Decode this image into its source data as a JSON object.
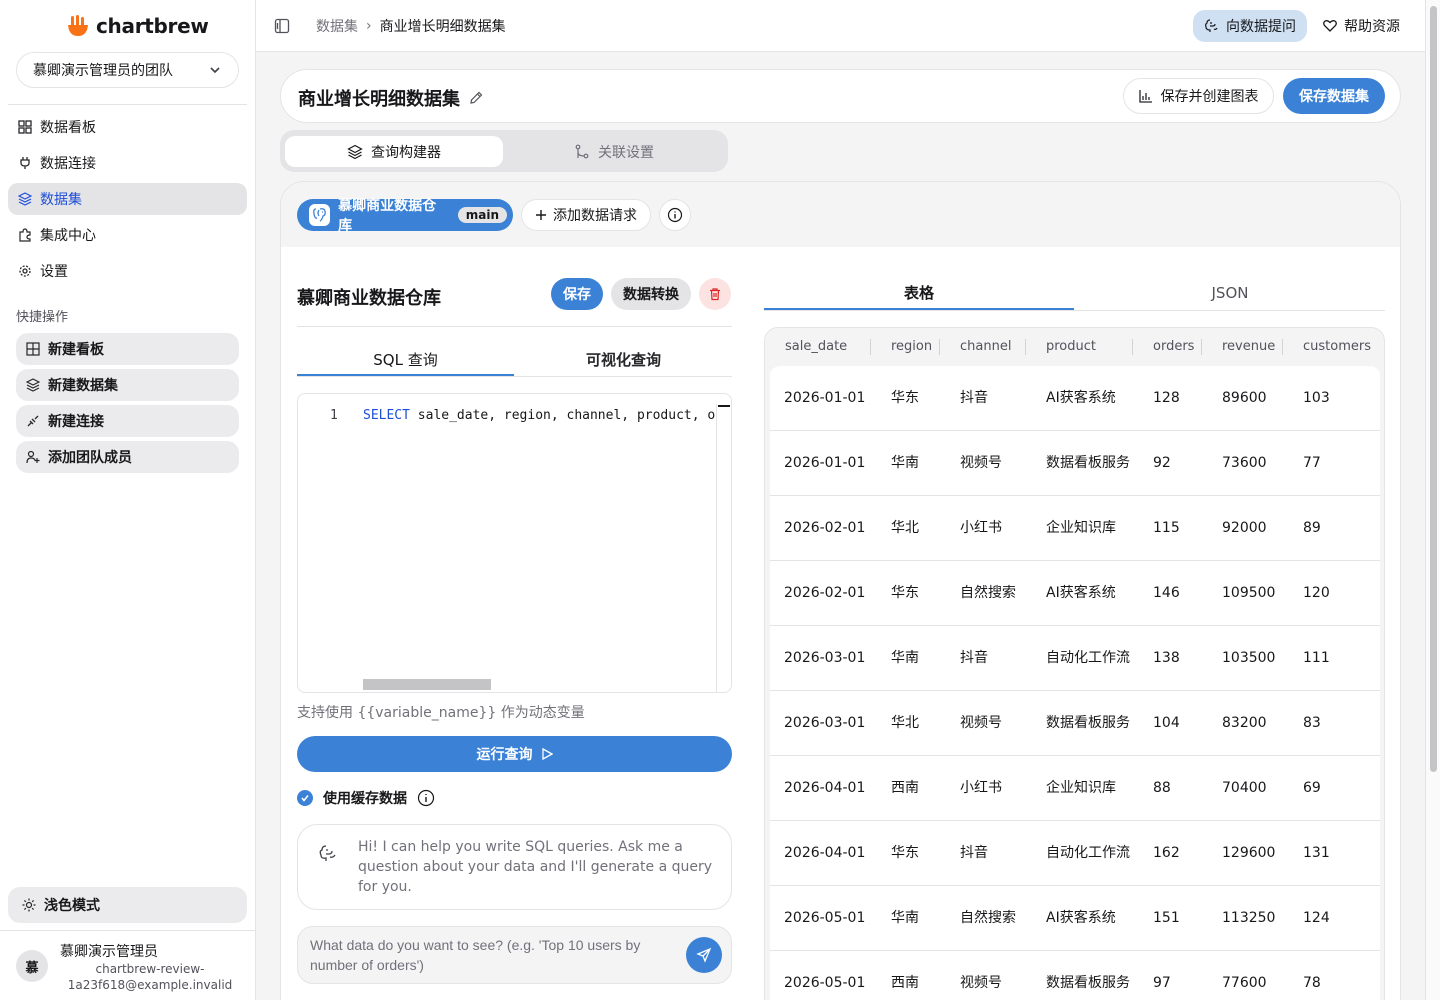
{
  "brand": {
    "name": "chartbrew",
    "accent": "#3b82d6",
    "logo_color": "#f97316"
  },
  "sidebar": {
    "team_name": "慕卿演示管理员的团队",
    "nav": [
      {
        "label": "数据看板",
        "icon": "dashboard-grid-icon",
        "active": false
      },
      {
        "label": "数据连接",
        "icon": "plug-icon",
        "active": false
      },
      {
        "label": "数据集",
        "icon": "layers-icon",
        "active": true
      },
      {
        "label": "集成中心",
        "icon": "puzzle-icon",
        "active": false
      },
      {
        "label": "设置",
        "icon": "gear-icon",
        "active": false
      }
    ],
    "quick_title": "快捷操作",
    "quick_actions": [
      {
        "label": "新建看板",
        "icon": "grid-plus-icon"
      },
      {
        "label": "新建数据集",
        "icon": "layers-plus-icon"
      },
      {
        "label": "新建连接",
        "icon": "plug-plus-icon"
      },
      {
        "label": "添加团队成员",
        "icon": "user-plus-icon"
      }
    ],
    "theme_label": "浅色模式",
    "user": {
      "avatar_text": "慕",
      "name": "慕卿演示管理员",
      "email": "chartbrew-review-1a23f618@example.invalid"
    }
  },
  "topbar": {
    "breadcrumb": [
      "数据集",
      "商业增长明细数据集"
    ],
    "ask_label": "向数据提问",
    "help_label": "帮助资源"
  },
  "dataset": {
    "title": "商业增长明细数据集",
    "save_and_chart_label": "保存并创建图表",
    "save_label": "保存数据集"
  },
  "mode_tabs": {
    "builder": "查询构建器",
    "relations": "关联设置"
  },
  "connection": {
    "name": "慕卿商业数据仓库",
    "badge": "main"
  },
  "add_request_label": "添加数据请求",
  "request": {
    "title": "慕卿商业数据仓库",
    "save_label": "保存",
    "transform_label": "数据转换",
    "tabs": {
      "sql": "SQL 查询",
      "visual": "可视化查询"
    },
    "line_number": "1",
    "sql_keyword": "SELECT",
    "sql_rest": " sale_date, region, channel, product, orders, revenue, customers FROM business_growth",
    "variable_hint": "支持使用 {{variable_name}} 作为动态变量",
    "run_label": "运行查询",
    "cache_label": "使用缓存数据",
    "cache_checked": true,
    "ai_message": "Hi! I can help you write SQL queries. Ask me a question about your data and I'll generate a query for you.",
    "ai_placeholder": "What data do you want to see? (e.g. 'Top 10 users by number of orders')"
  },
  "results": {
    "tabs": {
      "table": "表格",
      "json": "JSON"
    },
    "columns": [
      "sale_date",
      "region",
      "channel",
      "product",
      "orders",
      "revenue",
      "customers"
    ],
    "rows": [
      [
        "2026-01-01",
        "华东",
        "抖音",
        "AI获客系统",
        "128",
        "89600",
        "103"
      ],
      [
        "2026-01-01",
        "华南",
        "视频号",
        "数据看板服务",
        "92",
        "73600",
        "77"
      ],
      [
        "2026-02-01",
        "华北",
        "小红书",
        "企业知识库",
        "115",
        "92000",
        "89"
      ],
      [
        "2026-02-01",
        "华东",
        "自然搜索",
        "AI获客系统",
        "146",
        "109500",
        "120"
      ],
      [
        "2026-03-01",
        "华南",
        "抖音",
        "自动化工作流",
        "138",
        "103500",
        "111"
      ],
      [
        "2026-03-01",
        "华北",
        "视频号",
        "数据看板服务",
        "104",
        "83200",
        "83"
      ],
      [
        "2026-04-01",
        "西南",
        "小红书",
        "企业知识库",
        "88",
        "70400",
        "69"
      ],
      [
        "2026-04-01",
        "华东",
        "抖音",
        "自动化工作流",
        "162",
        "129600",
        "131"
      ],
      [
        "2026-05-01",
        "华南",
        "自然搜索",
        "AI获客系统",
        "151",
        "113250",
        "124"
      ],
      [
        "2026-05-01",
        "西南",
        "视频号",
        "数据看板服务",
        "97",
        "77600",
        "78"
      ]
    ]
  }
}
